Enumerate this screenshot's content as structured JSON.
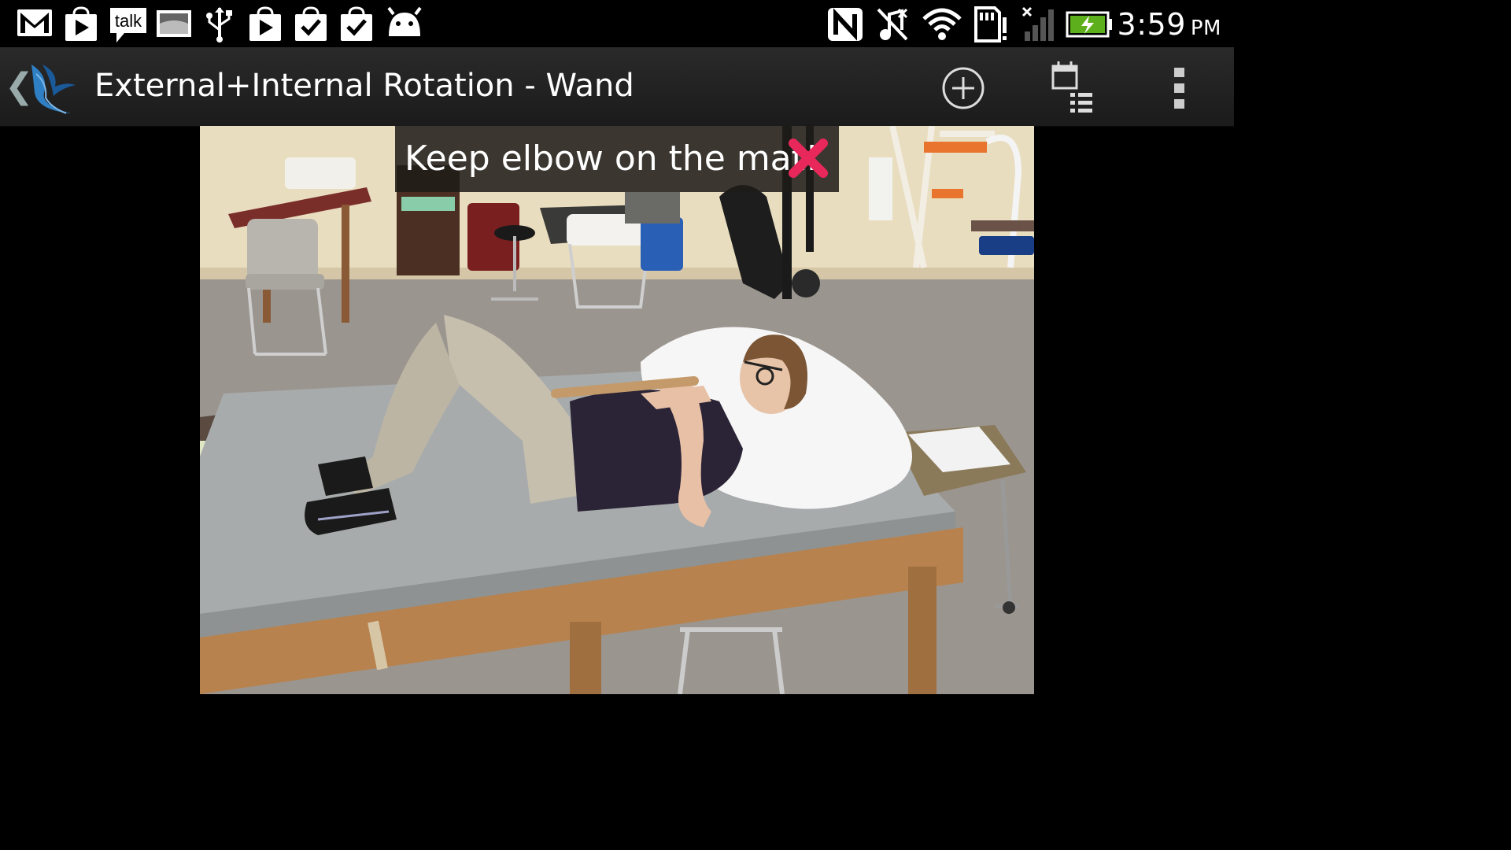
{
  "status_bar": {
    "time": "3:59",
    "ampm": "PM",
    "notification_icons": [
      "gmail-icon",
      "play-store-icon",
      "talk-icon",
      "gallery-icon",
      "usb-icon",
      "play-store-icon",
      "task-done-icon",
      "task-done-icon",
      "android-icon"
    ],
    "talk_label": "talk",
    "system_icons": [
      "nfc-icon",
      "mute-icon",
      "wifi-icon",
      "sd-card-warning-icon",
      "no-signal-icon",
      "battery-charging-icon"
    ]
  },
  "action_bar": {
    "title": "External+Internal Rotation - Wand",
    "actions": [
      "add-icon",
      "schedule-list-icon",
      "overflow-menu-icon"
    ]
  },
  "video": {
    "caption": "Keep elbow on the mat!",
    "caption_mark": "close-x-icon",
    "colors": {
      "caption_x": "#e8285a",
      "wall": "#e8dcc0",
      "floor": "#9a948e",
      "mat": "#a9adae",
      "bed_frame": "#b98550"
    }
  }
}
